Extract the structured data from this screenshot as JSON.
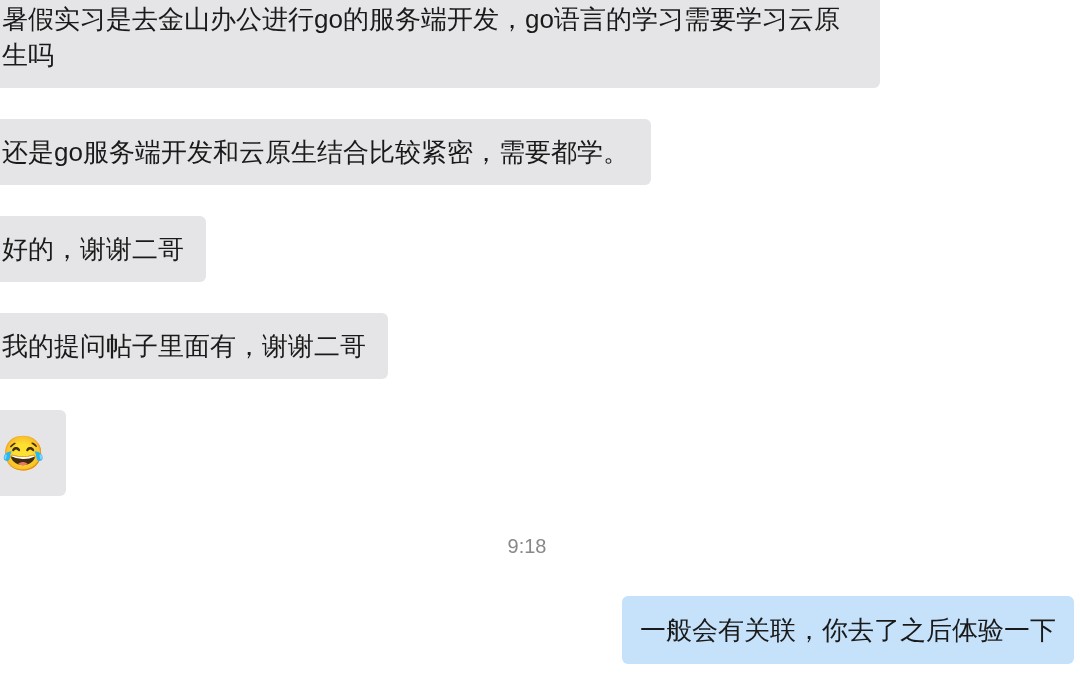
{
  "messages": [
    {
      "kind": "bubble",
      "outgoing": false,
      "text": "暑假实习是去金山办公进行go的服务端开发，go语言的学习需要学习云原生吗"
    },
    {
      "kind": "bubble",
      "outgoing": false,
      "text": "还是go服务端开发和云原生结合比较紧密，需要都学。"
    },
    {
      "kind": "bubble",
      "outgoing": false,
      "text": "好的，谢谢二哥"
    },
    {
      "kind": "bubble",
      "outgoing": false,
      "text": "我的提问帖子里面有，谢谢二哥"
    },
    {
      "kind": "emoji",
      "outgoing": false,
      "text": "😂"
    },
    {
      "kind": "time",
      "text": "9:18"
    },
    {
      "kind": "bubble",
      "outgoing": true,
      "text": "一般会有关联，你去了之后体验一下"
    }
  ]
}
